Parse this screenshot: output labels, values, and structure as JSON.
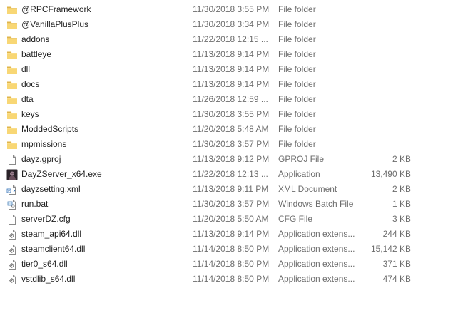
{
  "files": [
    {
      "name": "@RPCFramework",
      "date": "11/30/2018 3:55 PM",
      "type": "File folder",
      "size": "",
      "icon": "folder-icon"
    },
    {
      "name": "@VanillaPlusPlus",
      "date": "11/30/2018 3:34 PM",
      "type": "File folder",
      "size": "",
      "icon": "folder-icon"
    },
    {
      "name": "addons",
      "date": "11/22/2018 12:15 ...",
      "type": "File folder",
      "size": "",
      "icon": "folder-icon"
    },
    {
      "name": "battleye",
      "date": "11/13/2018 9:14 PM",
      "type": "File folder",
      "size": "",
      "icon": "folder-icon"
    },
    {
      "name": "dll",
      "date": "11/13/2018 9:14 PM",
      "type": "File folder",
      "size": "",
      "icon": "folder-icon"
    },
    {
      "name": "docs",
      "date": "11/13/2018 9:14 PM",
      "type": "File folder",
      "size": "",
      "icon": "folder-icon"
    },
    {
      "name": "dta",
      "date": "11/26/2018 12:59 ...",
      "type": "File folder",
      "size": "",
      "icon": "folder-icon"
    },
    {
      "name": "keys",
      "date": "11/30/2018 3:55 PM",
      "type": "File folder",
      "size": "",
      "icon": "folder-icon"
    },
    {
      "name": "ModdedScripts",
      "date": "11/20/2018 5:48 AM",
      "type": "File folder",
      "size": "",
      "icon": "folder-icon"
    },
    {
      "name": "mpmissions",
      "date": "11/30/2018 3:57 PM",
      "type": "File folder",
      "size": "",
      "icon": "folder-icon"
    },
    {
      "name": "dayz.gproj",
      "date": "11/13/2018 9:12 PM",
      "type": "GPROJ File",
      "size": "2 KB",
      "icon": "blank-file-icon"
    },
    {
      "name": "DayZServer_x64.exe",
      "date": "11/22/2018 12:13 ...",
      "type": "Application",
      "size": "13,490 KB",
      "icon": "dayz-app-icon"
    },
    {
      "name": "dayzsetting.xml",
      "date": "11/13/2018 9:11 PM",
      "type": "XML Document",
      "size": "2 KB",
      "icon": "xml-file-icon"
    },
    {
      "name": "run.bat",
      "date": "11/30/2018 3:57 PM",
      "type": "Windows Batch File",
      "size": "1 KB",
      "icon": "batch-file-icon"
    },
    {
      "name": "serverDZ.cfg",
      "date": "11/20/2018 5:50 AM",
      "type": "CFG File",
      "size": "3 KB",
      "icon": "blank-file-icon"
    },
    {
      "name": "steam_api64.dll",
      "date": "11/13/2018 9:14 PM",
      "type": "Application extens...",
      "size": "244 KB",
      "icon": "dll-file-icon"
    },
    {
      "name": "steamclient64.dll",
      "date": "11/14/2018 8:50 PM",
      "type": "Application extens...",
      "size": "15,142 KB",
      "icon": "dll-file-icon"
    },
    {
      "name": "tier0_s64.dll",
      "date": "11/14/2018 8:50 PM",
      "type": "Application extens...",
      "size": "371 KB",
      "icon": "dll-file-icon"
    },
    {
      "name": "vstdlib_s64.dll",
      "date": "11/14/2018 8:50 PM",
      "type": "Application extens...",
      "size": "474 KB",
      "icon": "dll-file-icon"
    }
  ],
  "colors": {
    "folder": "#f8d775",
    "folder_dark": "#e0b54a",
    "name_text": "#1e1e1e",
    "meta_text": "#6d6d6d"
  }
}
